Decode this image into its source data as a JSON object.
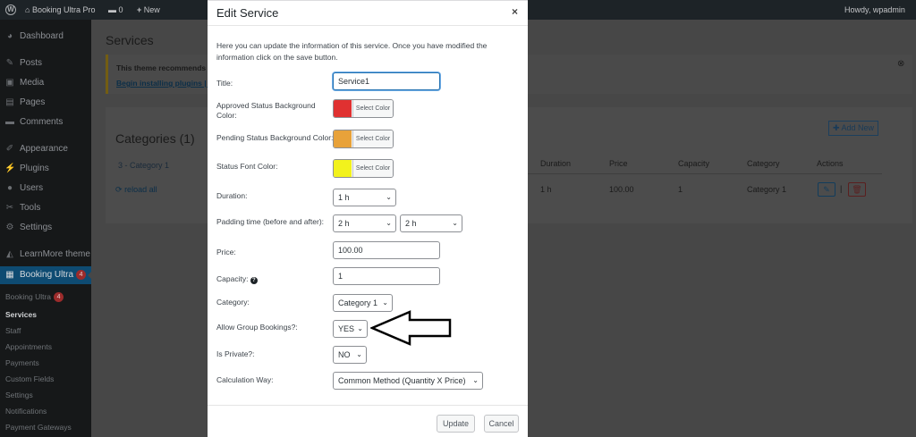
{
  "adminbar": {
    "site_name": "Booking Ultra Pro",
    "comments_count": "0",
    "new_label": "New",
    "greeting": "Howdy, wpadmin"
  },
  "sidebar": {
    "items": [
      {
        "label": "Dashboard",
        "icon": "dashboard-icon"
      },
      {
        "label": "Posts",
        "icon": "pin-icon"
      },
      {
        "label": "Media",
        "icon": "media-icon"
      },
      {
        "label": "Pages",
        "icon": "pages-icon"
      },
      {
        "label": "Comments",
        "icon": "comment-icon"
      },
      {
        "label": "Appearance",
        "icon": "brush-icon"
      },
      {
        "label": "Plugins",
        "icon": "plugin-icon"
      },
      {
        "label": "Users",
        "icon": "user-icon"
      },
      {
        "label": "Tools",
        "icon": "wrench-icon"
      },
      {
        "label": "Settings",
        "icon": "settings-icon"
      },
      {
        "label": "LearnMore theme",
        "icon": "graduation-icon"
      },
      {
        "label": "Booking Ultra",
        "icon": "calendar-icon",
        "badge": "4"
      }
    ],
    "submenu": [
      {
        "label": "Booking Ultra",
        "badge": "4"
      },
      {
        "label": "Services"
      },
      {
        "label": "Staff"
      },
      {
        "label": "Appointments"
      },
      {
        "label": "Payments"
      },
      {
        "label": "Custom Fields"
      },
      {
        "label": "Settings"
      },
      {
        "label": "Notifications"
      },
      {
        "label": "Payment Gateways"
      }
    ]
  },
  "background": {
    "page_title": "Services",
    "notice_text": "This theme recommends t",
    "notice_link": "Begin installing plugins | D",
    "categories_title": "Categories (1)",
    "category_item": "3 - Category 1",
    "reload": "reload all",
    "add_new": "Add New",
    "columns": [
      "Duration",
      "Price",
      "Capacity",
      "Category",
      "Actions"
    ],
    "row": [
      "1 h",
      "100.00",
      "1",
      "Category 1"
    ]
  },
  "modal": {
    "title": "Edit Service",
    "close": "×",
    "intro": "Here you can update the information of this service. Once you have modified the information click on the save button.",
    "fields": {
      "title_label": "Title:",
      "title_value": "Service1",
      "approved_label": "Approved Status Background Color:",
      "pending_label": "Pending Status Background Color:",
      "font_label": "Status Font Color:",
      "select_color": "Select Color",
      "duration_label": "Duration:",
      "duration_value": "1 h",
      "padding_label": "Padding time (before and after):",
      "padding_before": "2 h",
      "padding_after": "2 h",
      "price_label": "Price:",
      "price_value": "100.00",
      "capacity_label": "Capacity:",
      "capacity_value": "1",
      "category_label": "Category:",
      "category_value": "Category 1",
      "group_label": "Allow Group Bookings?:",
      "group_value": "YES",
      "private_label": "Is Private?:",
      "private_value": "NO",
      "calc_label": "Calculation Way:",
      "calc_value": "Common Method (Quantity X Price)"
    },
    "colors": {
      "approved": "#e03131",
      "pending": "#e8a23a",
      "font": "#f2f21c"
    },
    "buttons": {
      "update": "Update",
      "cancel": "Cancel"
    }
  }
}
